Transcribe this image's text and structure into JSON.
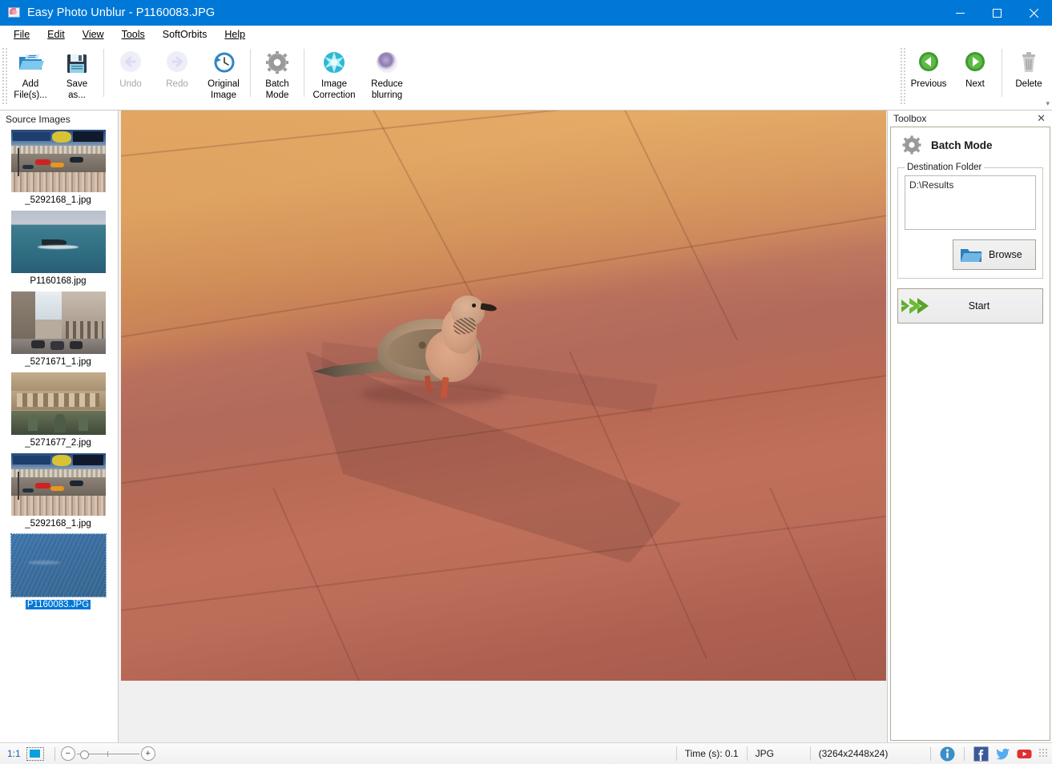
{
  "window": {
    "title": "Easy Photo Unblur - P1160083.JPG",
    "icon": "app-photo-icon",
    "minimize": "minimize-icon",
    "maximize": "maximize-icon",
    "close": "close-icon",
    "accent_color": "#0078d7"
  },
  "menubar": {
    "items": [
      {
        "label": "File",
        "accel": "F"
      },
      {
        "label": "Edit",
        "accel": "E"
      },
      {
        "label": "View",
        "accel": "V"
      },
      {
        "label": "Tools",
        "accel": "T"
      },
      {
        "label": "SoftOrbits",
        "accel": ""
      },
      {
        "label": "Help",
        "accel": "H"
      }
    ]
  },
  "toolbar": {
    "buttons": [
      {
        "id": "add-files",
        "label": "Add\nFile(s)...",
        "icon": "open-folder-icon",
        "enabled": true
      },
      {
        "id": "save-as",
        "label": "Save\nas...",
        "icon": "floppy-save-icon",
        "enabled": true
      },
      {
        "id": "undo",
        "label": "Undo",
        "icon": "arrow-left-circle-icon",
        "enabled": false
      },
      {
        "id": "redo",
        "label": "Redo",
        "icon": "arrow-right-circle-icon",
        "enabled": false
      },
      {
        "id": "original-image",
        "label": "Original\nImage",
        "icon": "clock-rewind-icon",
        "enabled": true
      },
      {
        "id": "batch-mode",
        "label": "Batch\nMode",
        "icon": "gear-icon",
        "enabled": true
      },
      {
        "id": "image-correction",
        "label": "Image\nCorrection",
        "icon": "cyan-burst-icon",
        "enabled": true
      },
      {
        "id": "reduce-blurring",
        "label": "Reduce\nblurring",
        "icon": "purple-blur-icon",
        "enabled": true
      }
    ],
    "right_buttons": [
      {
        "id": "previous",
        "label": "Previous",
        "icon": "green-back-icon"
      },
      {
        "id": "next",
        "label": "Next",
        "icon": "green-forward-icon"
      },
      {
        "id": "delete",
        "label": "Delete",
        "icon": "trash-icon"
      }
    ],
    "overflow": "overflow-chevron-icon"
  },
  "source_panel": {
    "title": "Source Images",
    "thumbnails": [
      {
        "caption": "_5292168_1.jpg",
        "art": "f1",
        "selected": false
      },
      {
        "caption": "P1160168.jpg",
        "art": "sea",
        "selected": false
      },
      {
        "caption": "_5271671_1.jpg",
        "art": "street",
        "selected": false
      },
      {
        "caption": "_5271677_2.jpg",
        "art": "arch",
        "selected": false
      },
      {
        "caption": "_5292168_1.jpg",
        "art": "f1",
        "selected": false
      },
      {
        "caption": "P1160083.JPG",
        "art": "blue",
        "selected": true
      }
    ]
  },
  "canvas": {
    "image_name": "P1160083.JPG",
    "alt": "Dove walking on red sandstone paving at sunset"
  },
  "toolbox": {
    "panel_title": "Toolbox",
    "close": "close-icon",
    "mode_icon": "gear-icon",
    "mode_title": "Batch Mode",
    "group_legend": "Destination Folder",
    "destination_value": "D:\\Results",
    "destination_placeholder": "",
    "browse_label": "Browse",
    "browse_icon": "folder-icon",
    "start_label": "Start",
    "start_icon": "green-double-arrow-icon"
  },
  "statusbar": {
    "zoom_ratio": "1:1",
    "fit_icon": "fit-to-window-icon",
    "zoom_out": "minus-icon",
    "zoom_in": "plus-icon",
    "time": "Time (s): 0.1",
    "format": "JPG",
    "dimensions": "(3264x2448x24)",
    "social": [
      {
        "id": "info",
        "icon": "info-icon",
        "color": "#3a8ec9"
      },
      {
        "id": "facebook",
        "icon": "facebook-icon",
        "color": "#3b5998"
      },
      {
        "id": "twitter",
        "icon": "twitter-icon",
        "color": "#55acee"
      },
      {
        "id": "youtube",
        "icon": "youtube-icon",
        "color": "#e02f2f"
      }
    ],
    "resize_grip": "resize-grip-icon"
  }
}
